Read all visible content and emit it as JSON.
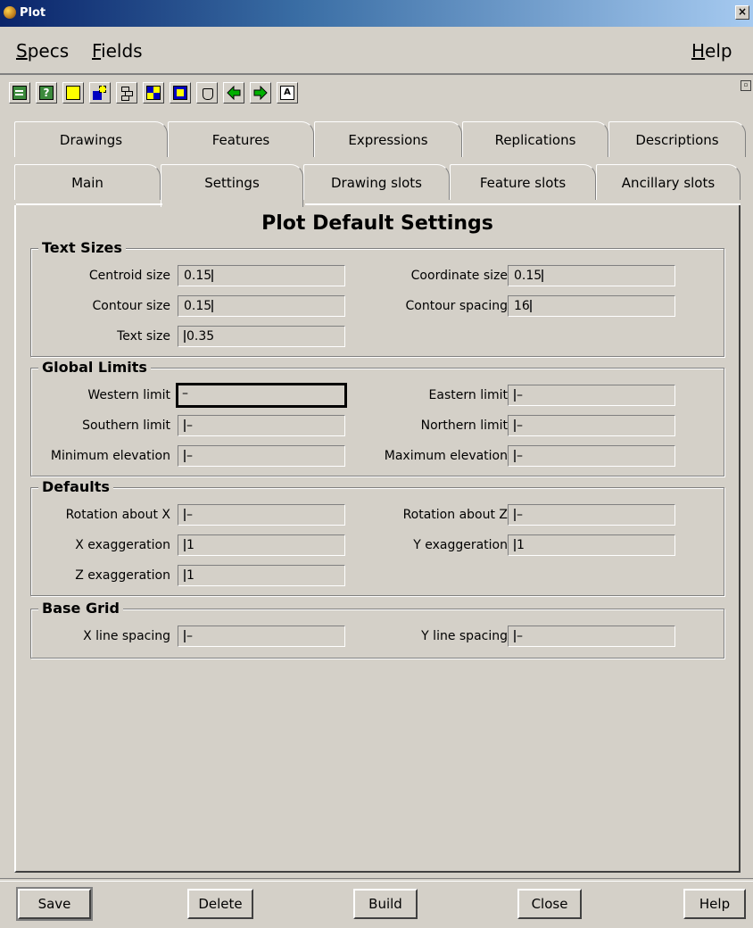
{
  "window": {
    "title": "Plot",
    "close_glyph": "×",
    "accent": "#0a246a"
  },
  "menubar": {
    "specs": {
      "first": "S",
      "rest": "pecs"
    },
    "fields": {
      "first": "F",
      "rest": "ields"
    },
    "help": {
      "first": "H",
      "rest": "elp"
    }
  },
  "toolbar": {
    "icons": [
      "open-file-icon",
      "help-icon",
      "blank-icon",
      "copy-icon",
      "tree-icon",
      "swap-icon",
      "highlight-icon",
      "bucket-icon",
      "back-arrow-icon",
      "forward-arrow-icon",
      "text-icon"
    ]
  },
  "tabs": {
    "back": [
      "Drawings",
      "Features",
      "Expressions",
      "Replications",
      "Descriptions"
    ],
    "front": [
      "Main",
      "Settings",
      "Drawing slots",
      "Feature slots",
      "Ancillary slots"
    ],
    "active": "Settings"
  },
  "panel": {
    "title": "Plot Default Settings",
    "text_sizes": {
      "title": "Text Sizes",
      "centroid_label": "Centroid size",
      "centroid_value": "0.15",
      "coordinate_label": "Coordinate size",
      "coordinate_value": "0.15",
      "contour_label": "Contour size",
      "contour_value": "0.15",
      "contour_spacing_label": "Contour spacing",
      "contour_spacing_value": "16",
      "text_label": "Text size",
      "text_value": "0.35"
    },
    "global_limits": {
      "title": "Global Limits",
      "western_label": "Western limit",
      "western_value": "–",
      "eastern_label": "Eastern limit",
      "eastern_value": "–",
      "southern_label": "Southern limit",
      "southern_value": "–",
      "northern_label": "Northern limit",
      "northern_value": "–",
      "min_elev_label": "Minimum elevation",
      "min_elev_value": "–",
      "max_elev_label": "Maximum elevation",
      "max_elev_value": "–"
    },
    "defaults": {
      "title": "Defaults",
      "rot_x_label": "Rotation about X",
      "rot_x_value": "–",
      "rot_z_label": "Rotation about Z",
      "rot_z_value": "–",
      "x_exag_label": "X exaggeration",
      "x_exag_value": "1",
      "y_exag_label": "Y exaggeration",
      "y_exag_value": "1",
      "z_exag_label": "Z exaggeration",
      "z_exag_value": "1"
    },
    "base_grid": {
      "title": "Base Grid",
      "x_spacing_label": "X line spacing",
      "x_spacing_value": "–",
      "y_spacing_label": "Y line spacing",
      "y_spacing_value": "–"
    }
  },
  "buttons": {
    "save": "Save",
    "delete": "Delete",
    "build": "Build",
    "close": "Close",
    "help": "Help"
  }
}
